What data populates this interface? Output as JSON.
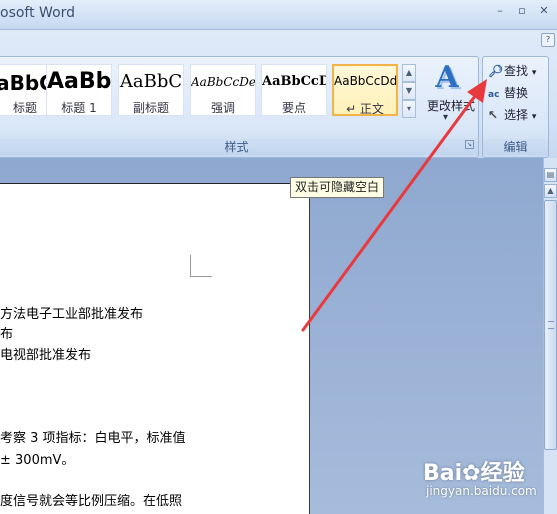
{
  "window": {
    "title": "osoft Word",
    "minimize": "–",
    "restore": "▫",
    "close": "✕"
  },
  "ribbon": {
    "help": "?",
    "styles_group": {
      "label": "样式",
      "tiles": [
        {
          "sample": "aBbC",
          "name": "标题",
          "selected": false
        },
        {
          "sample": "AaBb",
          "name": "标题 1",
          "selected": false
        },
        {
          "sample": "AaBbC",
          "name": "副标题",
          "selected": false
        },
        {
          "sample": "AaBbCcDe",
          "name": "强调",
          "selected": false
        },
        {
          "sample": "AaBbCcD",
          "name": "要点",
          "selected": false
        },
        {
          "sample": "AaBbCcDd",
          "name": "↵ 正文",
          "selected": true
        }
      ],
      "change_styles_label": "更改样式",
      "dropdown_arrow": "▾"
    },
    "edit_group": {
      "label": "编辑",
      "find": "查找",
      "replace": "替换",
      "select": "选择"
    }
  },
  "document": {
    "tooltip": "双击可隐藏空白",
    "lines": [
      "方法电子工业部批准发布",
      "布",
      "电视部批准发布",
      "考察 3 项指标：白电平，标准值",
      "± 300mV。",
      "度信号就会等比例压缩。在低照"
    ]
  },
  "watermark": {
    "logo": "Bai✿经验",
    "url": "jingyan.baidu.com"
  },
  "colors": {
    "annotation_arrow": "#e8393f",
    "selected_tile_border": "#f2b44a"
  }
}
